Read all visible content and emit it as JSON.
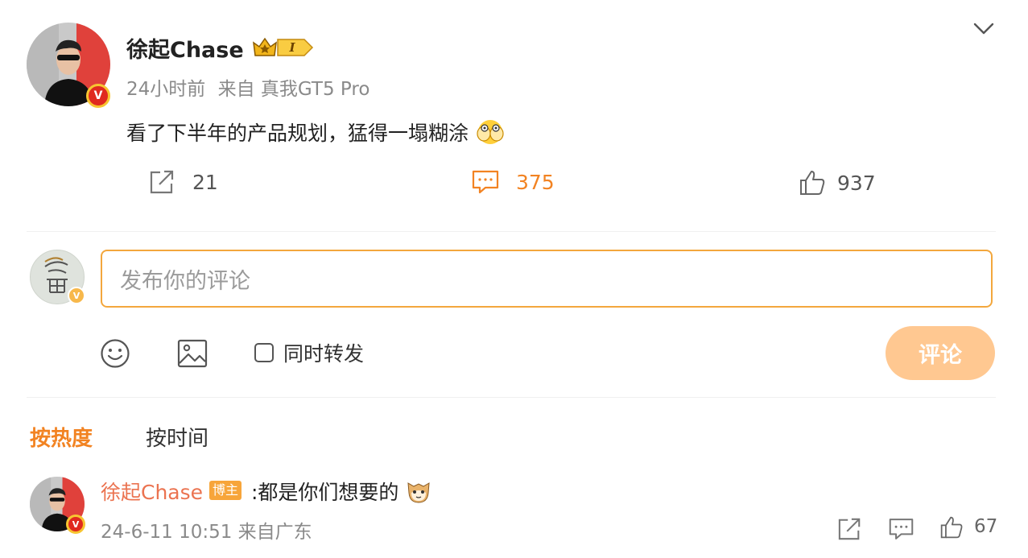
{
  "post": {
    "author": "徐起Chase",
    "level_badge": "I",
    "time": "24小时前",
    "source": "来自 真我GT5 Pro",
    "text": "看了下半年的产品规划，猛得一塌糊涂",
    "repost_count": "21",
    "comment_count": "375",
    "like_count": "937"
  },
  "composer": {
    "placeholder": "发布你的评论",
    "also_repost_label": "同时转发",
    "submit_label": "评论"
  },
  "sort": {
    "hot_label": "按热度",
    "time_label": "按时间"
  },
  "comments": [
    {
      "author": "徐起Chase",
      "tag": "博主",
      "text": ":都是你们想要的",
      "meta": "24-6-11 10:51 来自广东",
      "likes": "67"
    }
  ],
  "colors": {
    "accent_orange": "#f28322",
    "input_border": "#f3a73d",
    "submit_bg": "#ffc891",
    "name_link": "#eb7350",
    "verified_red": "#e02a1f"
  }
}
